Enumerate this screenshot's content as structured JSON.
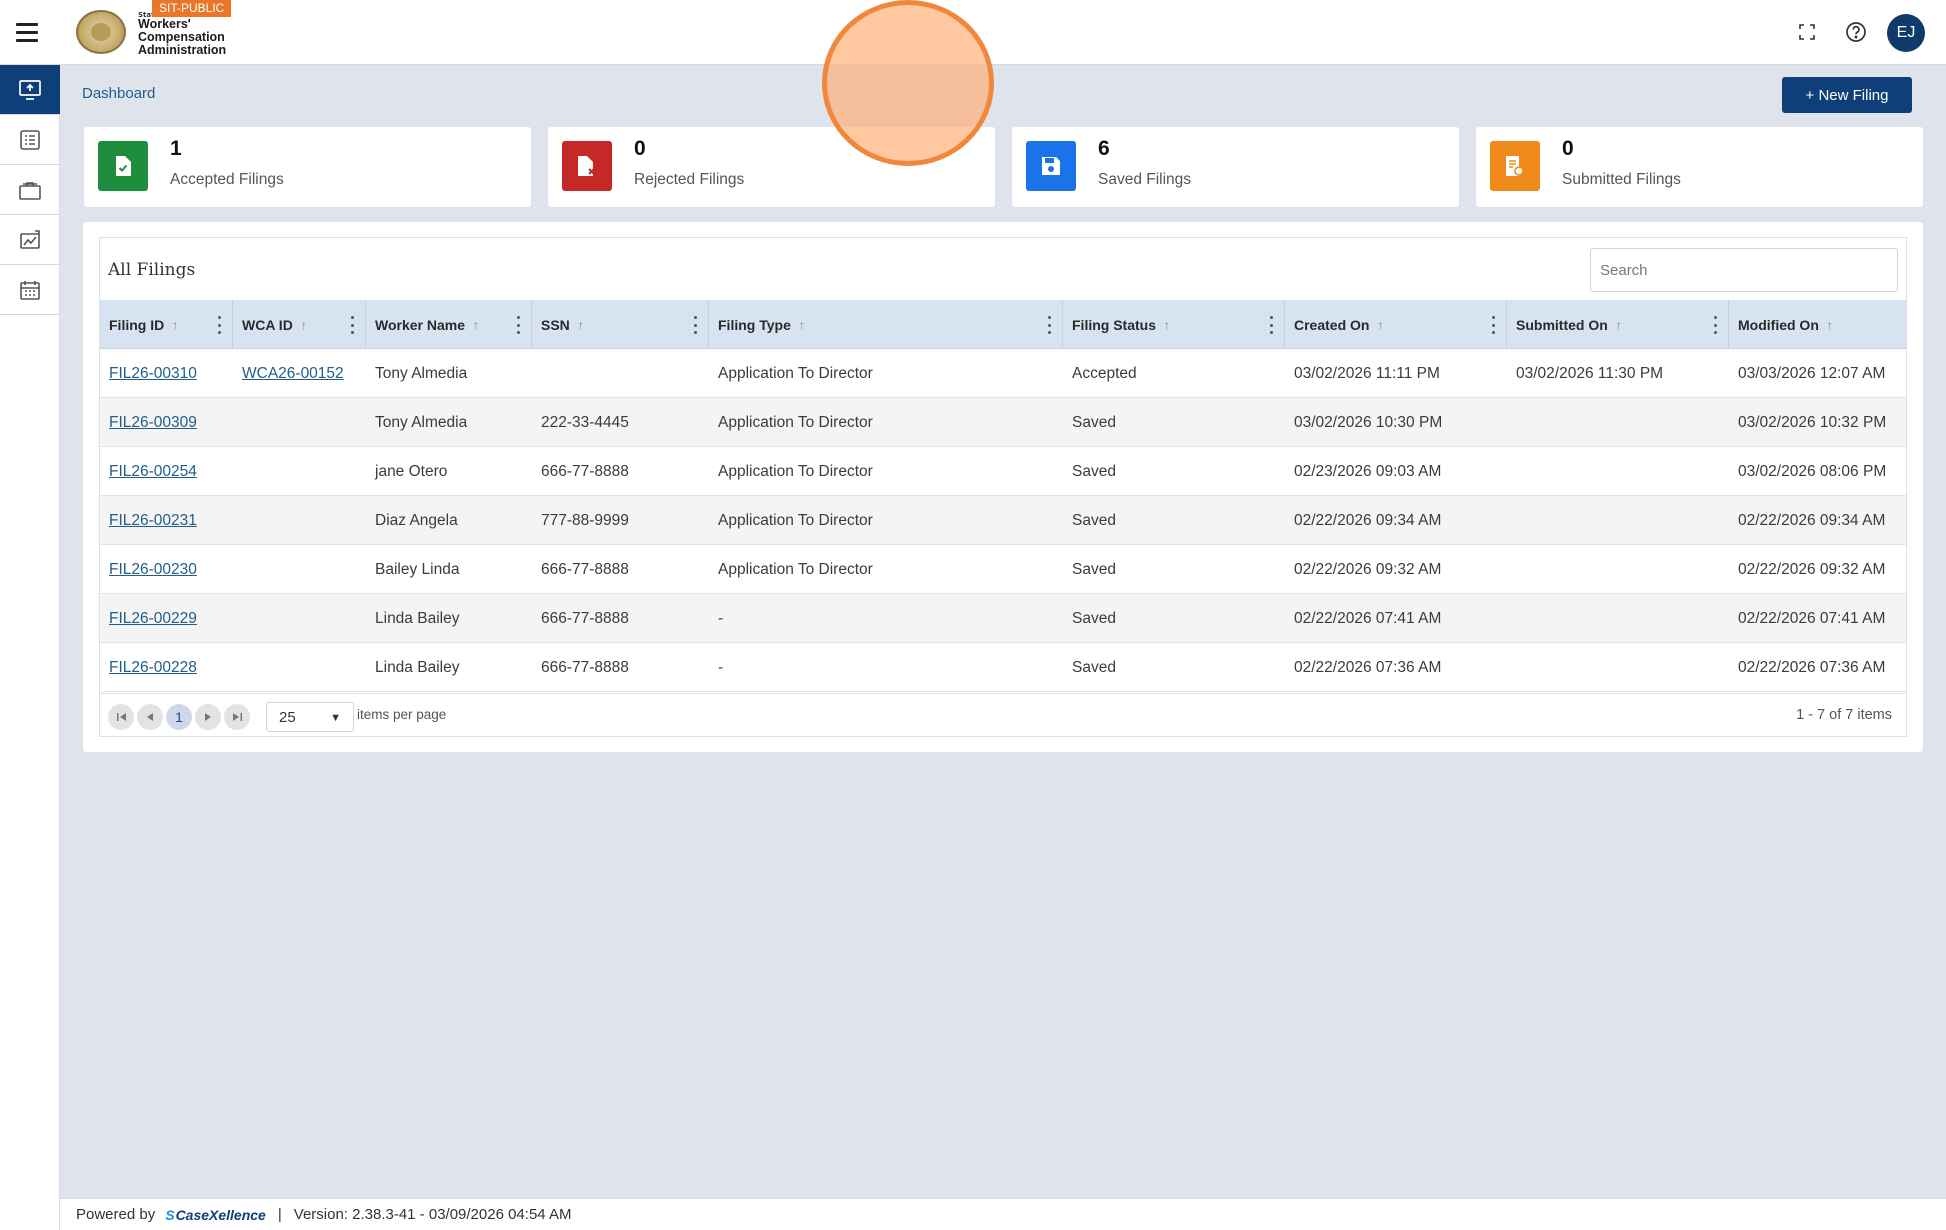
{
  "app": {
    "env_badge": "SIT-PUBLIC",
    "logo_small": "State",
    "logo_lines": [
      "Workers'",
      "Compensation",
      "Administration"
    ],
    "user_initials": "EJ"
  },
  "icons": {
    "menu": "hamburger-icon",
    "fullscreen": "fullscreen-icon",
    "help": "help-icon"
  },
  "sidebar": {
    "items": [
      {
        "icon": "monitor-upload-icon",
        "active": true
      },
      {
        "icon": "list-icon",
        "active": false
      },
      {
        "icon": "briefcase-icon",
        "active": false
      },
      {
        "icon": "chart-icon",
        "active": false
      },
      {
        "icon": "calendar-icon",
        "active": false
      }
    ]
  },
  "breadcrumb": "Dashboard",
  "new_filing_label": "+ New Filing",
  "stats": [
    {
      "count": "1",
      "label": "Accepted Filings",
      "color": "#1e8e3e",
      "icon": "file-check-icon"
    },
    {
      "count": "0",
      "label": "Rejected Filings",
      "color": "#c62828",
      "icon": "file-x-icon"
    },
    {
      "count": "6",
      "label": "Saved Filings",
      "color": "#1a73e8",
      "icon": "save-icon"
    },
    {
      "count": "0",
      "label": "Submitted Filings",
      "color": "#ef8a1a",
      "icon": "file-submit-icon"
    }
  ],
  "table": {
    "title": "All Filings",
    "search_placeholder": "Search",
    "columns": [
      "Filing ID",
      "WCA ID",
      "Worker Name",
      "SSN",
      "Filing Type",
      "Filing Status",
      "Created On",
      "Submitted On",
      "Modified On"
    ],
    "rows": [
      [
        "FIL26-00310",
        "WCA26-00152",
        "Tony Almedia",
        "",
        "Application To Director",
        "Accepted",
        "03/02/2026 11:11 PM",
        "03/02/2026 11:30 PM",
        "03/03/2026 12:07 AM"
      ],
      [
        "FIL26-00309",
        "",
        "Tony Almedia",
        "222-33-4445",
        "Application To Director",
        "Saved",
        "03/02/2026 10:30 PM",
        "",
        "03/02/2026 10:32 PM"
      ],
      [
        "FIL26-00254",
        "",
        "jane Otero",
        "666-77-8888",
        "Application To Director",
        "Saved",
        "02/23/2026 09:03 AM",
        "",
        "03/02/2026 08:06 PM"
      ],
      [
        "FIL26-00231",
        "",
        "Diaz Angela",
        "777-88-9999",
        "Application To Director",
        "Saved",
        "02/22/2026 09:34 AM",
        "",
        "02/22/2026 09:34 AM"
      ],
      [
        "FIL26-00230",
        "",
        "Bailey Linda",
        "666-77-8888",
        "Application To Director",
        "Saved",
        "02/22/2026 09:32 AM",
        "",
        "02/22/2026 09:32 AM"
      ],
      [
        "FIL26-00229",
        "",
        "Linda Bailey",
        "666-77-8888",
        "-",
        "Saved",
        "02/22/2026 07:41 AM",
        "",
        "02/22/2026 07:41 AM"
      ],
      [
        "FIL26-00228",
        "",
        "Linda Bailey",
        "666-77-8888",
        "-",
        "Saved",
        "02/22/2026 07:36 AM",
        "",
        "02/22/2026 07:36 AM"
      ]
    ]
  },
  "pager": {
    "current_page": "1",
    "page_size": "25",
    "items_per_page_label": "items per page",
    "info": "1 - 7 of 7 items"
  },
  "footer": {
    "powered_by": "Powered by",
    "brand": "CaseXellence",
    "separator": "|",
    "version": "Version: 2.38.3-41 - 03/09/2026 04:54 AM"
  }
}
